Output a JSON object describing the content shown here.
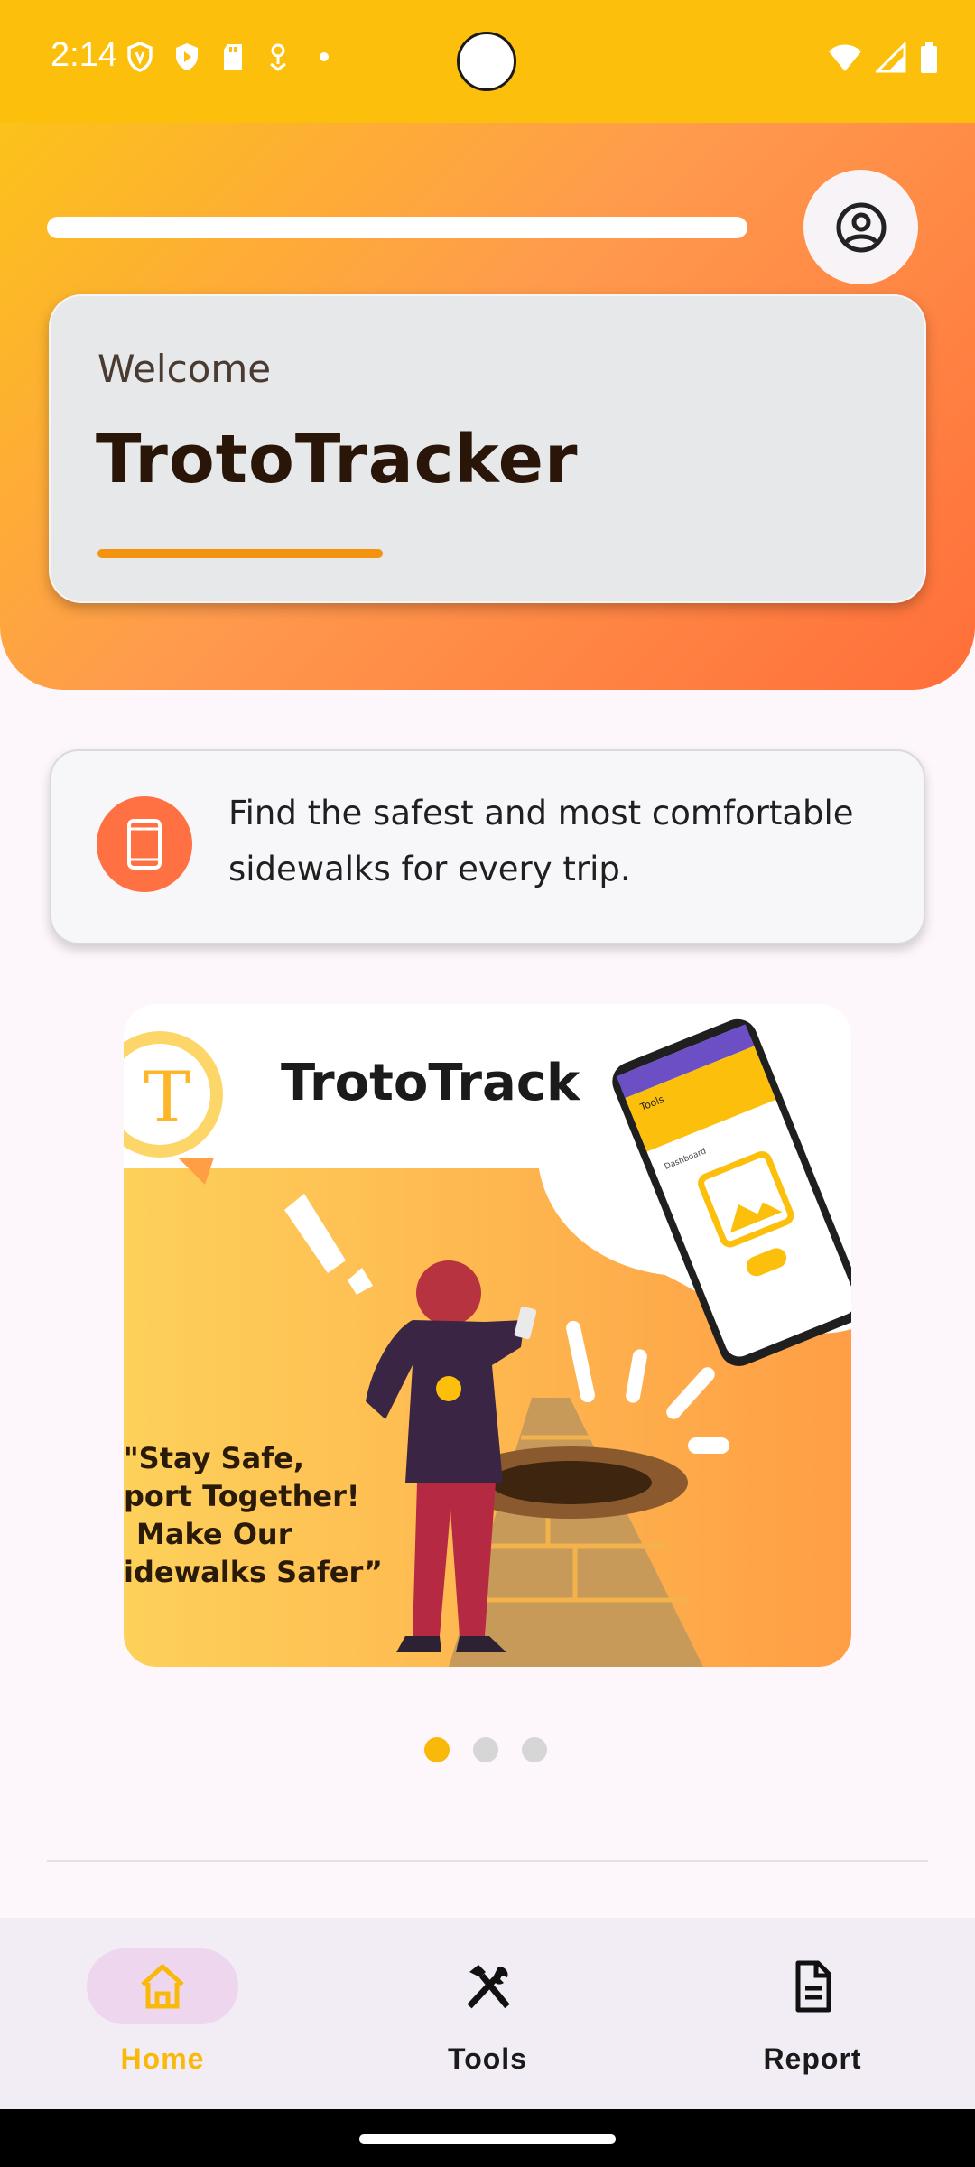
{
  "status_bar": {
    "time": "2:14",
    "left_icons": [
      "vpn-shield-icon",
      "play-protect-icon",
      "sd-card-icon",
      "location-icon",
      "notification-dot-icon"
    ],
    "right_icons": [
      "wifi-icon",
      "signal-icon",
      "battery-icon"
    ]
  },
  "header": {
    "search_bar_icon": "search-bar",
    "profile_icon": "account-circle-icon",
    "welcome_label": "Welcome",
    "app_title": "TrotoTracker"
  },
  "info_card": {
    "icon": "smartphone-icon",
    "text": "Find the safest and most comfortable sidewalks for every trip."
  },
  "banner": {
    "title": "TrotoTrack",
    "logo_letter": "T",
    "quote_lines": [
      "\"Stay Safe,",
      "port Together!",
      "Make Our",
      "idewalks Safer”"
    ],
    "phone_screen_title": "Tools",
    "phone_screen_label": "Dashboard"
  },
  "carousel": {
    "count": 3,
    "active_index": 0
  },
  "bottom_nav": {
    "items": [
      {
        "label": "Home",
        "icon": "home-icon",
        "active": true
      },
      {
        "label": "Tools",
        "icon": "tools-icon",
        "active": false
      },
      {
        "label": "Report",
        "icon": "document-icon",
        "active": false
      }
    ]
  },
  "colors": {
    "accent": "#fbbf0c",
    "header_gradient_end": "#ff6e3a",
    "info_icon_bg": "#ff7043",
    "underline": "#f39310",
    "dot_active": "#f8b90a"
  }
}
